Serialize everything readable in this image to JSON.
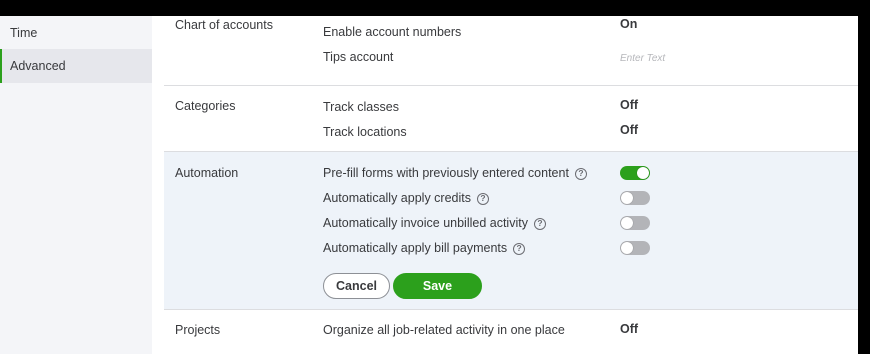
{
  "sidebar": {
    "items": [
      {
        "label": "Time"
      },
      {
        "label": "Advanced"
      }
    ]
  },
  "chart_of_accounts": {
    "title": "Chart of accounts",
    "enable_account_numbers": {
      "label": "Enable account numbers",
      "value": "On"
    },
    "tips_account": {
      "label": "Tips account",
      "placeholder": "Enter Text"
    }
  },
  "categories": {
    "title": "Categories",
    "track_classes": {
      "label": "Track classes",
      "value": "Off"
    },
    "track_locations": {
      "label": "Track locations",
      "value": "Off"
    }
  },
  "automation": {
    "title": "Automation",
    "settings": [
      {
        "label": "Pre-fill forms with previously entered content",
        "enabled": true
      },
      {
        "label": "Automatically apply credits",
        "enabled": false
      },
      {
        "label": "Automatically invoice unbilled activity",
        "enabled": false
      },
      {
        "label": "Automatically apply bill payments",
        "enabled": false
      }
    ],
    "help_glyph": "?",
    "cancel_label": "Cancel",
    "save_label": "Save"
  },
  "projects": {
    "title": "Projects",
    "organize": {
      "label": "Organize all job-related activity in one place",
      "value": "Off"
    }
  },
  "colors": {
    "accent": "#2ca01c",
    "sidebar_bg": "#f4f5f8",
    "active_section_bg": "#eef3f9",
    "toggle_off": "#b3b4b8"
  }
}
